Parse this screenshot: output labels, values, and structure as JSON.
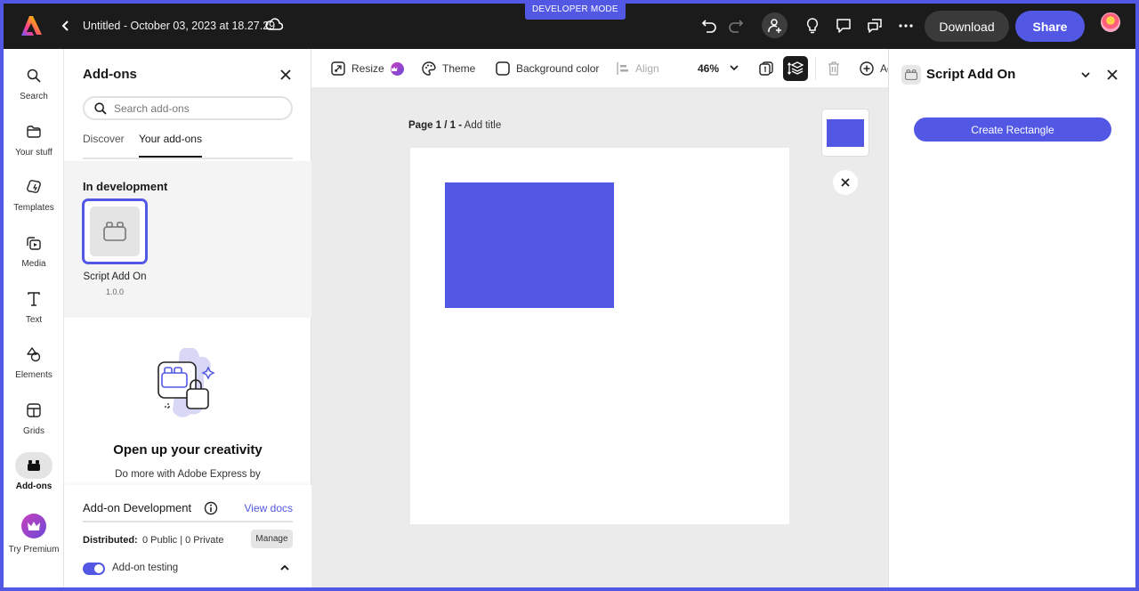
{
  "topbar": {
    "document_title": "Untitled - October 03, 2023 at 18.27.29",
    "developer_mode_label": "DEVELOPER MODE",
    "download_label": "Download",
    "share_label": "Share",
    "icons": [
      "adobe-express-logo",
      "chevron-left-icon",
      "cloud-icon",
      "undo-icon",
      "redo-icon",
      "invite-person-icon",
      "lightbulb-icon",
      "comment-icon",
      "comments-icon",
      "more-icon",
      "avatar"
    ]
  },
  "rail": {
    "items": [
      {
        "label": "Search",
        "icon": "search-icon"
      },
      {
        "label": "Your stuff",
        "icon": "folder-icon"
      },
      {
        "label": "Templates",
        "icon": "templates-icon"
      },
      {
        "label": "Media",
        "icon": "media-icon"
      },
      {
        "label": "Text",
        "icon": "text-icon"
      },
      {
        "label": "Elements",
        "icon": "shapes-icon"
      },
      {
        "label": "Grids",
        "icon": "grid-icon"
      },
      {
        "label": "Add-ons",
        "icon": "addons-icon",
        "active": true
      },
      {
        "label": "Try Premium",
        "icon": "crown-icon"
      }
    ]
  },
  "addons_panel": {
    "title": "Add-ons",
    "search_placeholder": "Search add-ons",
    "search_value": "",
    "tabs": [
      {
        "label": "Discover",
        "active": false
      },
      {
        "label": "Your add-ons",
        "active": true
      }
    ],
    "in_development": {
      "heading": "In development",
      "addons": [
        {
          "name": "Script Add On",
          "version": "1.0.0",
          "selected": true
        }
      ]
    },
    "promo": {
      "title": "Open up your creativity",
      "text": "Do more with Adobe Express by"
    },
    "development": {
      "title": "Add-on Development",
      "view_docs_label": "View docs",
      "distributed_label": "Distributed:",
      "distributed_value": "0 Public | 0 Private",
      "manage_label": "Manage",
      "testing_label": "Add-on testing",
      "testing_enabled": true
    }
  },
  "toolbar": {
    "resize_label": "Resize",
    "theme_label": "Theme",
    "background_color_label": "Background color",
    "align_label": "Align",
    "zoom_level": "46%",
    "add_label": "Ac"
  },
  "canvas": {
    "page_indicator": "Page 1 / 1 -",
    "page_title_placeholder": "Add title",
    "rectangle_color": "#5258e4"
  },
  "script_addon_panel": {
    "title": "Script Add On",
    "create_rectangle_label": "Create Rectangle"
  },
  "colors": {
    "accent": "#5258e4",
    "topbar_bg": "#1b1b1b",
    "canvas_bg": "#ebebeb"
  }
}
